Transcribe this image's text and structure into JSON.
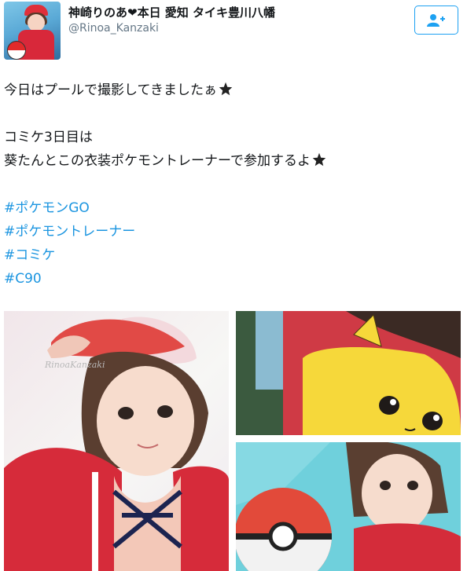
{
  "user": {
    "display_name": "神崎りのあ❤本日 愛知 タイキ豊川八幡",
    "handle": "@Rinoa_Kanzaki"
  },
  "follow_button": {
    "icon": "add-user-icon",
    "color": "#1da1f2"
  },
  "tweet": {
    "line1": "今日はプールで撮影してきましたぁ",
    "line2": "コミケ3日目は",
    "line3": "葵たんとこの衣装ポケモントレーナーで参加するよ",
    "hashtags": [
      "#ポケモンGO",
      "#ポケモントレーナー",
      "#コミケ",
      "#C90"
    ],
    "hashtag_color": "#1b95e0"
  },
  "media": {
    "watermark": "RinoaKanzaki"
  }
}
